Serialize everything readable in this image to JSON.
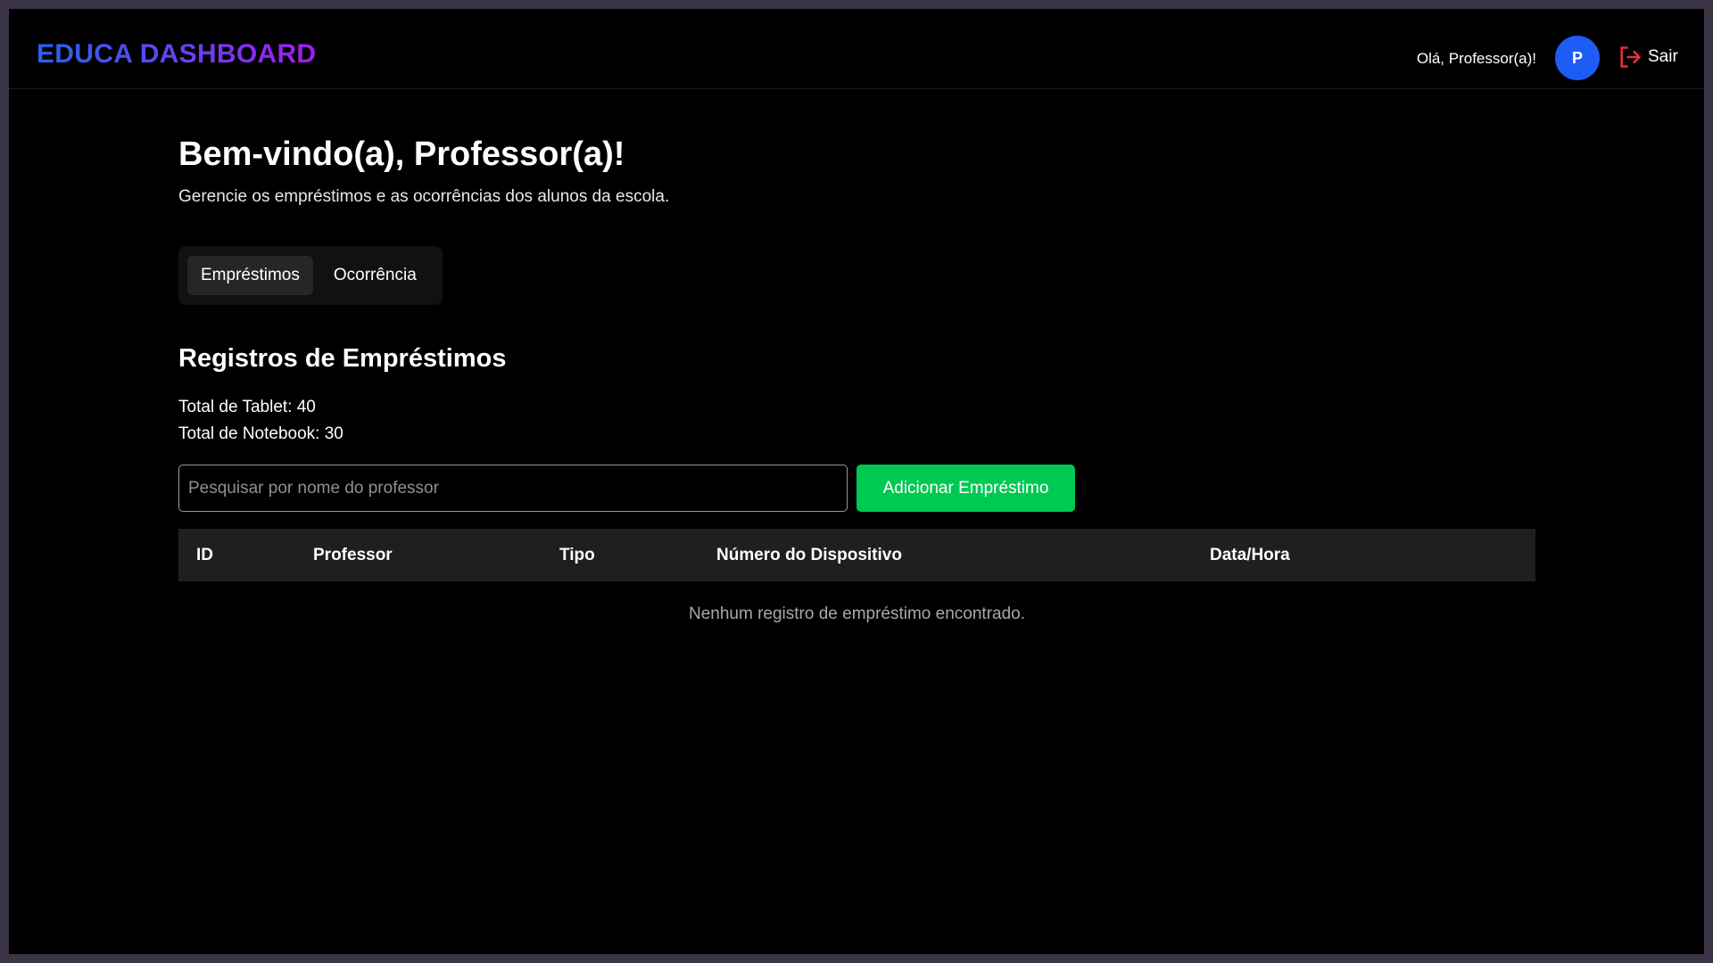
{
  "header": {
    "brand": "EDUCA DASHBOARD",
    "greeting": "Olá, Professor(a)!",
    "avatar_initial": "P",
    "logout_label": "Sair",
    "colors": {
      "avatar": "#1d5cf5",
      "logout_icon": "#e0323c"
    }
  },
  "main": {
    "title": "Bem-vindo(a), Professor(a)!",
    "subtitle": "Gerencie os empréstimos e as ocorrências dos alunos da escola.",
    "tabs": [
      {
        "label": "Empréstimos",
        "active": true
      },
      {
        "label": "Ocorrência",
        "active": false
      }
    ],
    "section_title": "Registros de Empréstimos",
    "totals": [
      "Total de Tablet: 40",
      "Total de Notebook: 30"
    ],
    "search": {
      "placeholder": "Pesquisar por nome do professor",
      "value": ""
    },
    "add_button": {
      "label": "Adicionar Empréstimo",
      "color": "#00c952"
    },
    "table": {
      "columns": [
        "ID",
        "Professor",
        "Tipo",
        "Número do Dispositivo",
        "Data/Hora"
      ],
      "rows": [],
      "empty_message": "Nenhum registro de empréstimo encontrado."
    }
  }
}
